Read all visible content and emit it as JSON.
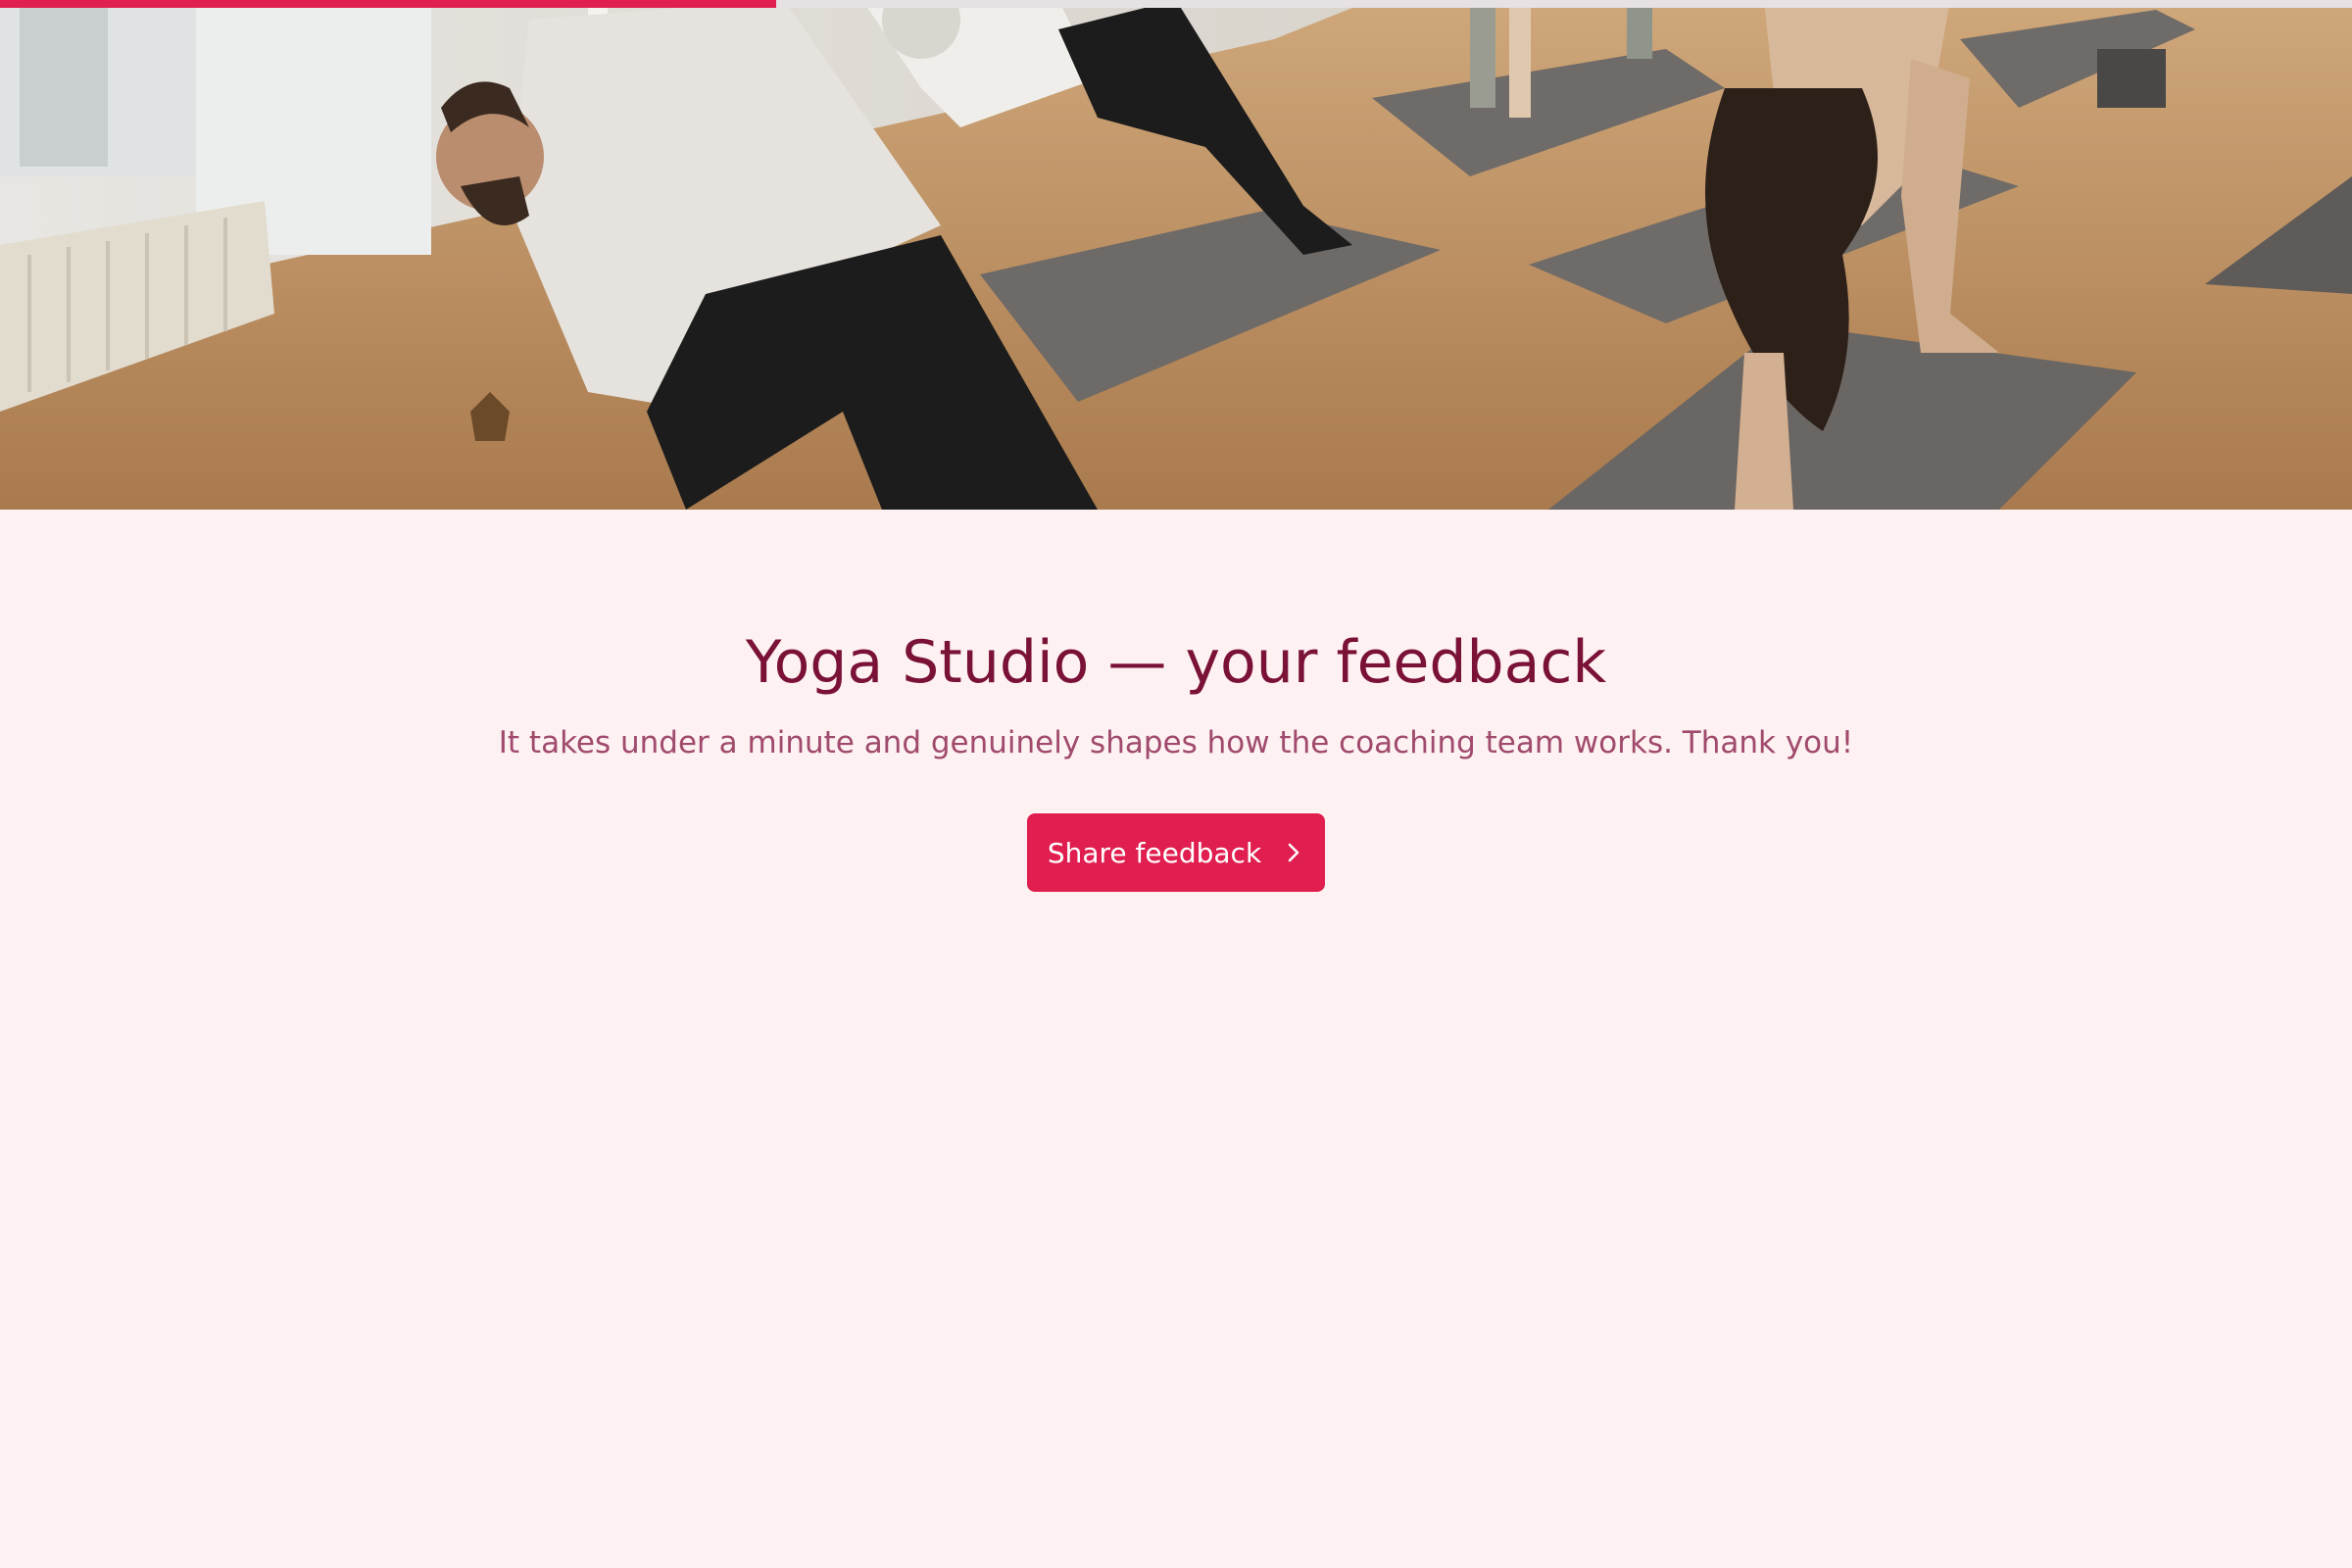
{
  "progress": {
    "fraction": 0.33,
    "fill_color": "#e01e4f",
    "track_color": "#e6e1e3"
  },
  "hero": {
    "image_semantic": "yoga-class-photo"
  },
  "survey": {
    "title": "Yoga Studio — your feedback",
    "subtitle": "It takes under a minute and genuinely shapes how the coaching team works. Thank you!",
    "cta_label": "Share feedback",
    "cta_icon": "chevron-right-icon"
  },
  "colors": {
    "background": "#fdf1f2",
    "title": "#7a1136",
    "subtitle": "#a04a6c",
    "accent": "#e01e4f"
  }
}
